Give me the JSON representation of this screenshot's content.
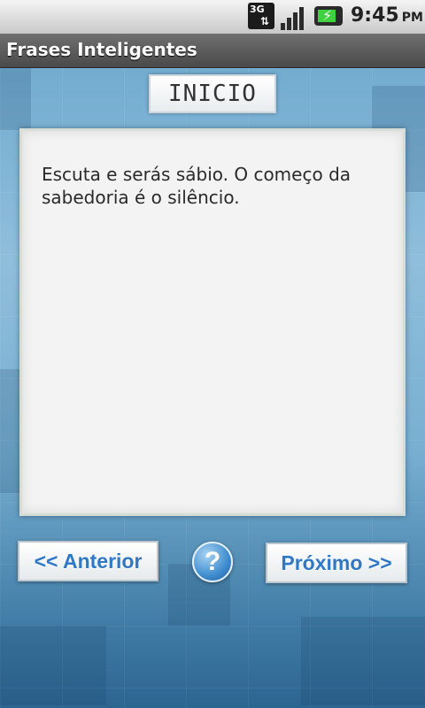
{
  "status_bar": {
    "network_label": "3G",
    "time": "9:45",
    "ampm": "PM",
    "icons": [
      "3g-data-icon",
      "signal-icon",
      "battery-charging-icon"
    ]
  },
  "app": {
    "title": "Frases Inteligentes"
  },
  "section": {
    "label": "INICIO"
  },
  "quote": {
    "text": "Escuta e serás sábio. O começo da sabedoria é o silêncio."
  },
  "buttons": {
    "previous": "<< Anterior",
    "help": "?",
    "next": "Próximo >>"
  },
  "colors": {
    "accent": "#2f78c6",
    "background": "#7fb4d5"
  }
}
